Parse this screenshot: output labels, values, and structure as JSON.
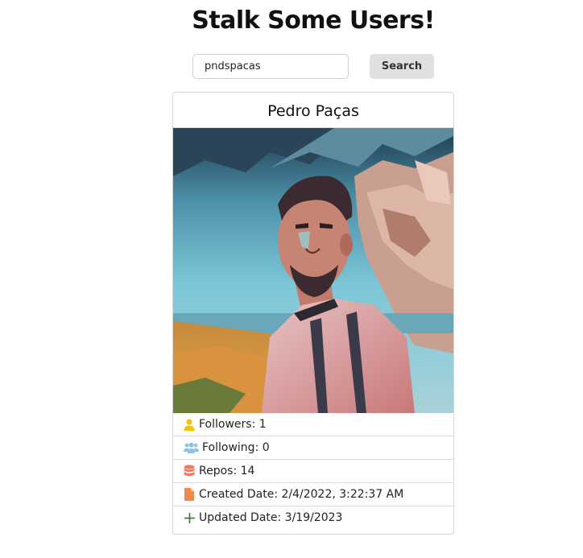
{
  "page": {
    "title": "Stalk Some Users!"
  },
  "search": {
    "value": "pndspacas",
    "button_label": "Search"
  },
  "profile": {
    "name": "Pedro Paças",
    "stats": [
      {
        "icon": "user-icon",
        "color": "#f5c400",
        "label": "Followers: 1"
      },
      {
        "icon": "users-icon",
        "color": "#8ec5e0",
        "label": "Following: 0"
      },
      {
        "icon": "database-icon",
        "color": "#f07b62",
        "label": "Repos: 14"
      },
      {
        "icon": "file-icon",
        "color": "#f08a4b",
        "label": "Created Date: 2/4/2022, 3:22:37 AM"
      },
      {
        "icon": "plus-icon",
        "color": "#2e7d32",
        "label": "Updated Date: 3/19/2023"
      }
    ]
  }
}
